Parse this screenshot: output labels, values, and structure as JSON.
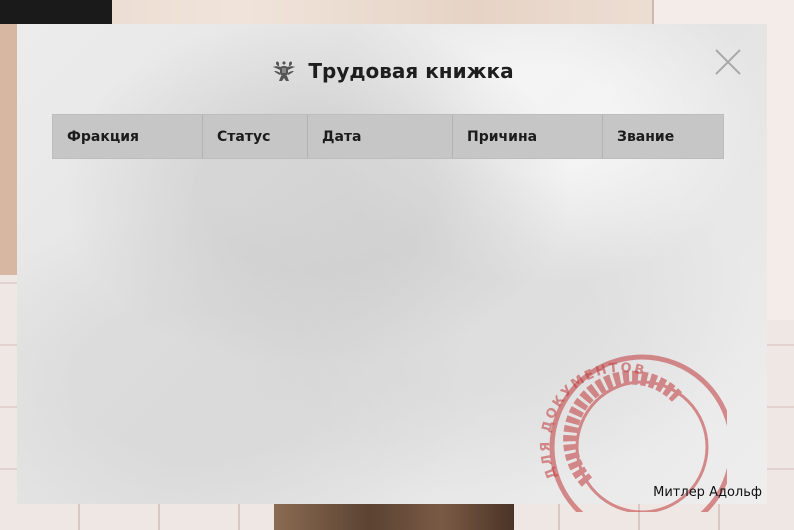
{
  "dialog": {
    "title": "Трудовая книжка",
    "emblem_icon": "coat-of-arms-icon",
    "close_icon": "close-icon"
  },
  "table": {
    "columns": [
      "Фракция",
      "Статус",
      "Дата",
      "Причина",
      "Звание"
    ],
    "rows": []
  },
  "stamp": {
    "text": "ДЛЯ ДОКУМЕНТОВ",
    "color": "#c0393b"
  },
  "footer": {
    "owner_name": "Митлер Адольф"
  }
}
